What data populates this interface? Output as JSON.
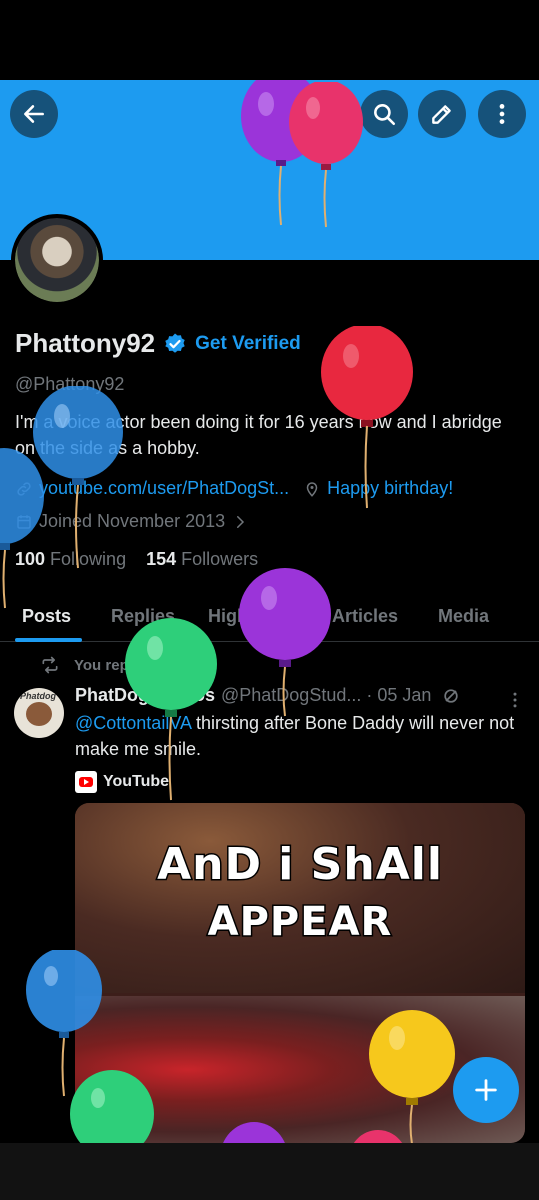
{
  "profile": {
    "display_name": "Phattony92",
    "get_verified_label": "Get Verified",
    "handle": "@Phattony92",
    "bio": "I'm a voice actor been doing it for 16 years now and I abridge on the side as a hobby.",
    "link": "youtube.com/user/PhatDogSt...",
    "location": "Happy birthday!",
    "joined": "Joined November 2013",
    "following_count": "100",
    "following_label": "Following",
    "followers_count": "154",
    "followers_label": "Followers"
  },
  "tabs": [
    "Posts",
    "Replies",
    "Highlights",
    "Articles",
    "Media"
  ],
  "post": {
    "repost_label": "You reposted",
    "author": "PhatDogStudios",
    "handle_date": "@PhatDogStud... · 05 Jan",
    "mention": "@CottontailVA",
    "text": " thirsting after Bone Daddy will never not make me smile.",
    "source": "YouTube",
    "avatar_text": "Phatdog",
    "caption_line1": "AnD i ShAll",
    "caption_line2": "APPEAR"
  },
  "colors": {
    "accent": "#1d9bf0",
    "banner": "#1d9bf0",
    "background": "#000000",
    "muted_text": "#71767b"
  },
  "icons": [
    "back-arrow-icon",
    "grok-icon",
    "search-icon",
    "edit-icon",
    "more-vertical-icon",
    "verified-icon",
    "link-icon",
    "location-icon",
    "calendar-icon",
    "chevron-right-icon",
    "repost-icon",
    "more-horizontal-icon",
    "youtube-icon",
    "plus-icon"
  ]
}
